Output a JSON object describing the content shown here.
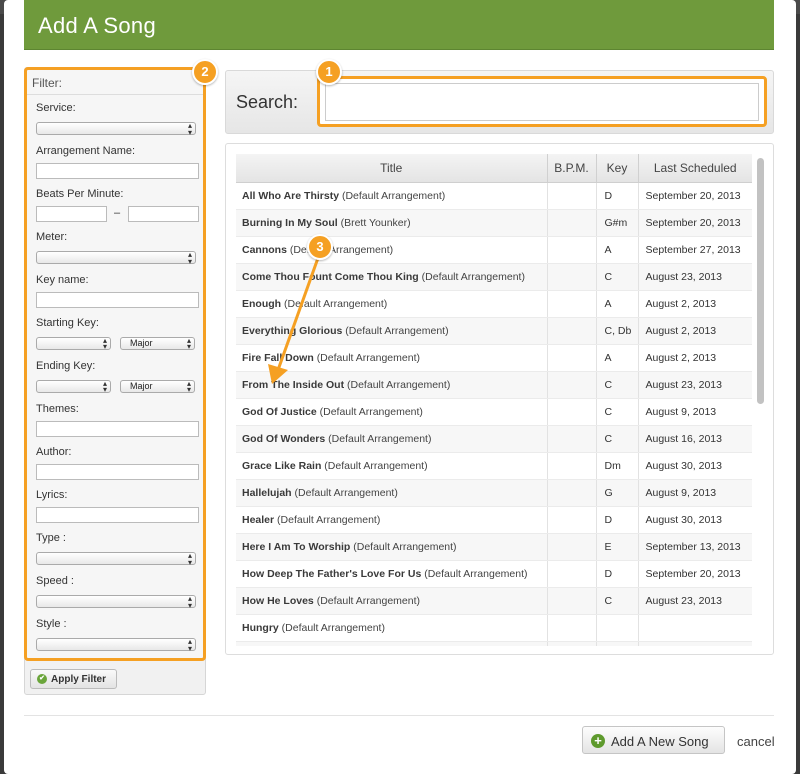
{
  "modal": {
    "title": "Add A Song"
  },
  "filter": {
    "heading": "Filter:",
    "service_label": "Service:",
    "arrangement_label": "Arrangement Name:",
    "bpm_label": "Beats Per Minute:",
    "bpm_separator": "–",
    "meter_label": "Meter:",
    "key_name_label": "Key name:",
    "starting_key_label": "Starting Key:",
    "starting_key_mode": "Major",
    "ending_key_label": "Ending Key:",
    "ending_key_mode": "Major",
    "themes_label": "Themes:",
    "author_label": "Author:",
    "lyrics_label": "Lyrics:",
    "type_label": "Type :",
    "speed_label": "Speed :",
    "style_label": "Style :",
    "apply_label": "Apply Filter"
  },
  "badges": {
    "one": "1",
    "two": "2",
    "three": "3"
  },
  "search": {
    "label": "Search:",
    "value": "",
    "placeholder": ""
  },
  "table": {
    "headers": {
      "title": "Title",
      "bpm": "B.P.M.",
      "key": "Key",
      "last_scheduled": "Last Scheduled"
    },
    "rows": [
      {
        "title": "All Who Are Thirsty",
        "arrangement": "(Default Arrangement)",
        "bpm": "",
        "key": "D",
        "last": "September 20, 2013"
      },
      {
        "title": "Burning In My Soul",
        "arrangement": "(Brett Younker)",
        "bpm": "",
        "key": "G#m",
        "last": "September 20, 2013"
      },
      {
        "title": "Cannons",
        "arrangement": "(Default Arrangement)",
        "bpm": "",
        "key": "A",
        "last": "September 27, 2013"
      },
      {
        "title": "Come Thou Fount Come Thou King",
        "arrangement": "(Default Arrangement)",
        "bpm": "",
        "key": "C",
        "last": "August 23, 2013"
      },
      {
        "title": "Enough",
        "arrangement": "(Default Arrangement)",
        "bpm": "",
        "key": "A",
        "last": "August 2, 2013"
      },
      {
        "title": "Everything Glorious",
        "arrangement": "(Default Arrangement)",
        "bpm": "",
        "key": "C, Db",
        "last": "August 2, 2013"
      },
      {
        "title": "Fire Fall Down",
        "arrangement": "(Default Arrangement)",
        "bpm": "",
        "key": "A",
        "last": "August 2, 2013"
      },
      {
        "title": "From The Inside Out",
        "arrangement": "(Default Arrangement)",
        "bpm": "",
        "key": "C",
        "last": "August 23, 2013"
      },
      {
        "title": "God Of Justice",
        "arrangement": "(Default Arrangement)",
        "bpm": "",
        "key": "C",
        "last": "August 9, 2013"
      },
      {
        "title": "God Of Wonders",
        "arrangement": "(Default Arrangement)",
        "bpm": "",
        "key": "C",
        "last": "August 16, 2013"
      },
      {
        "title": "Grace Like Rain",
        "arrangement": "(Default Arrangement)",
        "bpm": "",
        "key": "Dm",
        "last": "August 30, 2013"
      },
      {
        "title": "Hallelujah",
        "arrangement": "(Default Arrangement)",
        "bpm": "",
        "key": "G",
        "last": "August 9, 2013"
      },
      {
        "title": "Healer",
        "arrangement": "(Default Arrangement)",
        "bpm": "",
        "key": "D",
        "last": "August 30, 2013"
      },
      {
        "title": "Here I Am To Worship",
        "arrangement": "(Default Arrangement)",
        "bpm": "",
        "key": "E",
        "last": "September 13, 2013"
      },
      {
        "title": "How Deep The Father's Love For Us",
        "arrangement": "(Default Arrangement)",
        "bpm": "",
        "key": "D",
        "last": "September 20, 2013"
      },
      {
        "title": "How He Loves",
        "arrangement": "(Default Arrangement)",
        "bpm": "",
        "key": "C",
        "last": "August 23, 2013"
      },
      {
        "title": "Hungry",
        "arrangement": "(Default Arrangement)",
        "bpm": "",
        "key": "",
        "last": ""
      },
      {
        "title": "",
        "arrangement": "",
        "bpm": "",
        "key": "",
        "last": ""
      }
    ]
  },
  "footer": {
    "add_new_song_label": "Add A New Song",
    "cancel_label": "cancel"
  },
  "colors": {
    "titlebar": "#6f9a3c",
    "highlight": "#f5a023",
    "add_icon": "#5e9a2d"
  },
  "icons": {
    "apply": "check-circle-icon",
    "add": "plus-circle-icon",
    "select_arrow": "updown-arrow-icon"
  }
}
